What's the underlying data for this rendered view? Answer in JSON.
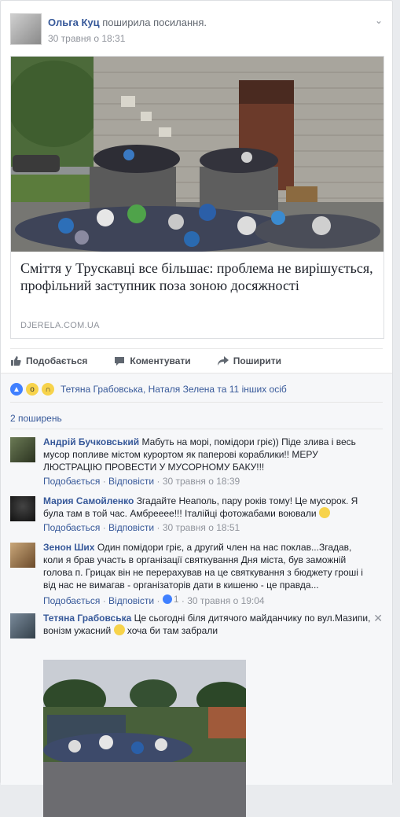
{
  "post": {
    "author": "Ольга Куц",
    "action": "поширила посилання.",
    "time": "30 травня о 18:31"
  },
  "link_preview": {
    "title": "Сміття у Трускавці все більшає: проблема не вирішується, профільний заступник поза зоною досяжності",
    "domain": "DJERELA.COM.UA"
  },
  "actions": {
    "like": "Подобається",
    "comment": "Коментувати",
    "share": "Поширити"
  },
  "reactions": {
    "text": "Тетяна Грабовська, Наталя Зелена та 11 інших осіб"
  },
  "shares": "2 поширень",
  "comments": [
    {
      "name": "Андрій Бучковський",
      "text": "Мабуть на морі, помідори гріє)) Піде злива і весь мусор попливе містом курортом як паперові кораблики!! МЕРУ ЛЮСТРАЦІЮ ПРОВЕСТИ У МУСОРНОМУ БАКУ!!!",
      "like": "Подобається",
      "reply": "Відповісти",
      "time": "30 травня о 18:39"
    },
    {
      "name": "Мария Самойленко",
      "text": "Згадайте Неаполь, пару років тому! Це мусорок. Я була там в той час. Амбрееее!!! Італійці фотожабами воювали",
      "like": "Подобається",
      "reply": "Відповісти",
      "time": "30 травня о 18:51"
    },
    {
      "name": "Зенон Ших",
      "text": "Один помідори гріє, а другий член на нас поклав...Згадав, коли я брав участь в організації святкування Дня міста, був заможній голова п. Грицак він не перерахував на це святкування з бюджету гроші і від нас не вимагав - організаторів дати в кишеню - це правда...",
      "like": "Подобається",
      "reply": "Відповісти",
      "likes": "1",
      "time": "30 травня о 19:04"
    },
    {
      "name": "Тетяна Грабовська",
      "text": "Це сьогодні біля дитячого майданчику по вул.Мазипи, вонізм ужасний",
      "text2": "хоча би там забрали"
    }
  ]
}
